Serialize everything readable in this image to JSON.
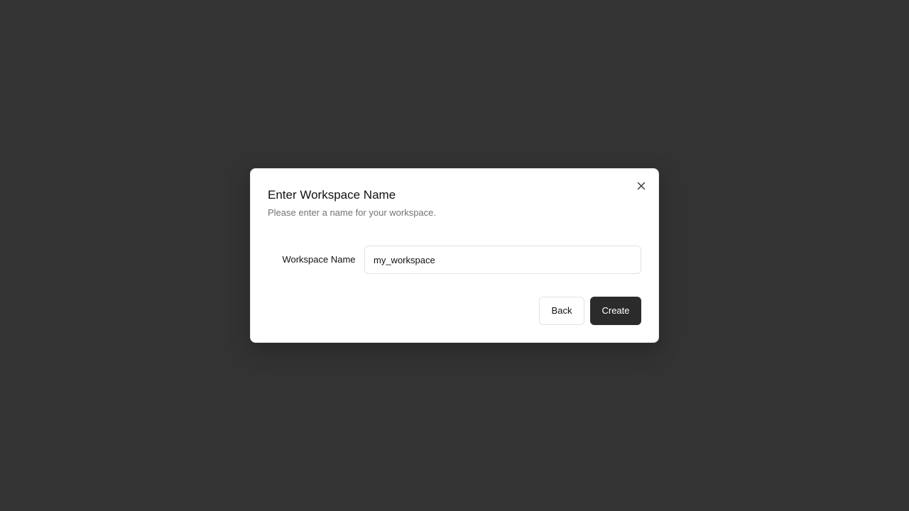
{
  "dialog": {
    "title": "Enter Workspace Name",
    "subtitle": "Please enter a name for your workspace.",
    "close_icon": "close-icon",
    "field": {
      "label": "Workspace Name",
      "value": "my_workspace",
      "placeholder": ""
    },
    "buttons": {
      "back_label": "Back",
      "create_label": "Create"
    }
  },
  "colors": {
    "backdrop": "#333333",
    "dialog_background": "#ffffff",
    "primary_button": "#2b2b2b",
    "subtitle_text": "#737373"
  }
}
